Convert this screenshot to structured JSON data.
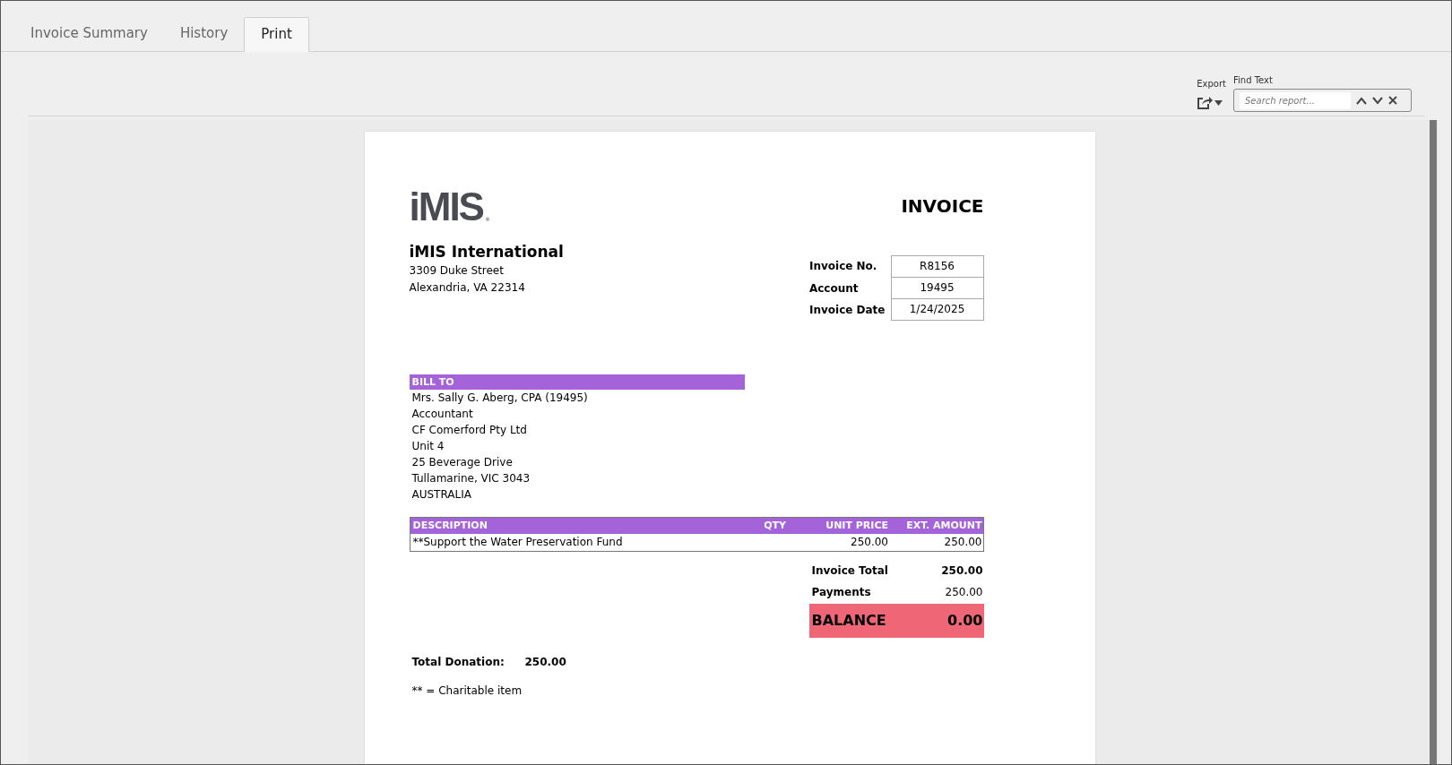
{
  "tabs": [
    {
      "label": "Invoice Summary",
      "selected": false
    },
    {
      "label": "History",
      "selected": false
    },
    {
      "label": "Print",
      "selected": true
    }
  ],
  "toolbar": {
    "export_label": "Export",
    "find_label": "Find Text",
    "search": {
      "placeholder": "Search report..."
    }
  },
  "report": {
    "logo": {
      "text": "iMIS",
      "mark": "®"
    },
    "title": "INVOICE",
    "company": {
      "name": "iMIS International",
      "address": [
        "3309 Duke Street",
        "Alexandria, VA 22314"
      ]
    },
    "details": [
      {
        "label": "Invoice No.",
        "value": "R8156"
      },
      {
        "label": "Account",
        "value": "19495"
      },
      {
        "label": "Invoice Date",
        "value": "1/24/2025"
      }
    ],
    "bill_to": {
      "heading": "BILL TO",
      "lines": [
        "Mrs. Sally G. Aberg, CPA (19495)",
        "Accountant",
        "CF Comerford Pty Ltd",
        "Unit 4",
        "25 Beverage Drive",
        "Tullamarine, VIC 3043",
        "AUSTRALIA"
      ]
    },
    "items": {
      "columns": [
        "DESCRIPTION",
        "QTY",
        "UNIT PRICE",
        "EXT. AMOUNT"
      ],
      "rows": [
        [
          "**Support the Water Preservation Fund",
          "",
          "250.00",
          "250.00"
        ]
      ]
    },
    "totals": [
      {
        "label": "Invoice Total",
        "value": "250.00",
        "kind": "total"
      },
      {
        "label": "Payments",
        "value": "250.00",
        "kind": "payment"
      },
      {
        "label": "BALANCE",
        "value": "0.00",
        "kind": "balance"
      }
    ],
    "donation": {
      "label": "Total Donation:",
      "value": "250.00"
    },
    "footnote": "** = Charitable item"
  }
}
